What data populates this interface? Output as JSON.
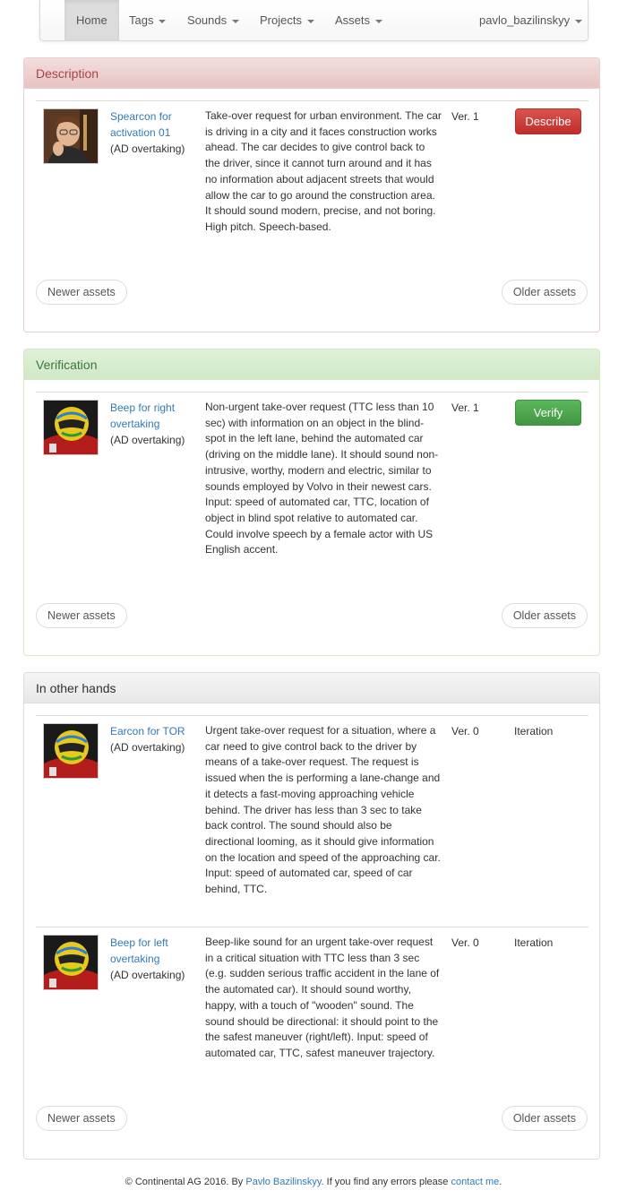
{
  "nav": {
    "home": "Home",
    "tags": "Tags",
    "sounds": "Sounds",
    "projects": "Projects",
    "assets": "Assets",
    "user": "pavlo_bazilinskyy"
  },
  "description_panel": {
    "heading": "Description",
    "item": {
      "title": "Spearcon for activation 01",
      "project": "(AD overtaking)",
      "description": "Take-over request for urban environment. The car is driving in a city and it faces construction works ahead. The car decides to give control back to the driver, since it cannot turn around and it has no information about adjacent streets that would allow the car to go around the construction area. It should sound modern, precise, and not boring. High pitch. Speech-based.",
      "version": "Ver. 1",
      "action": "Describe"
    },
    "newer": "Newer assets",
    "older": "Older assets"
  },
  "verification_panel": {
    "heading": "Verification",
    "item": {
      "title": "Beep for right overtaking",
      "project": "(AD overtaking)",
      "description": "Non-urgent take-over request (TTC less than 10 sec) with information on an object in the blind-spot in the left lane, behind the automated car (driving on the middle lane). It should sound non-intrusive, worthy, modern and electric, similar to sounds employed by Volvo in their newest cars. Input: speed of automated car, TTC, location of object in blind spot relative to automated car. Could involve speech by a female actor with US English accent.",
      "version": "Ver. 1",
      "action": "Verify"
    },
    "newer": "Newer assets",
    "older": "Older assets"
  },
  "other_panel": {
    "heading": "In other hands",
    "items": [
      {
        "title": "Earcon for TOR",
        "project": "(AD overtaking)",
        "description": "Urgent take-over request for a situation, where a car need to give control back to the driver by means of a take-over request. The request is issued when the is performing a lane-change and it detects a fast-moving approaching vehicle behind. The driver has less than 3 sec to take back control. The sound should also be directional looming, as it should give information on the location and speed of the approaching car. Input: speed of automated car, speed of car behind, TTC.",
        "version": "Ver. 0",
        "status": "Iteration"
      },
      {
        "title": "Beep for left overtaking",
        "project": "(AD overtaking)",
        "description": "Beep-like sound for an urgent take-over request in a critical situation with TTC less than 3 sec (e.g. sudden serious traffic accident in the lane of the automated car). It should sound worthy, happy, with a touch of \"wooden\" sound. The sound should be directional: it should point to the the safest maneuver (right/left). Input: speed of automated car, TTC, safest maneuver trajectory.",
        "version": "Ver. 0",
        "status": "Iteration"
      }
    ],
    "newer": "Newer assets",
    "older": "Older assets"
  },
  "footer": {
    "copyright": "© Continental AG 2016. By ",
    "author": "Pavlo Bazilinskyy",
    "middle": ". If you find any errors please ",
    "contact": "contact me",
    "end": "."
  }
}
